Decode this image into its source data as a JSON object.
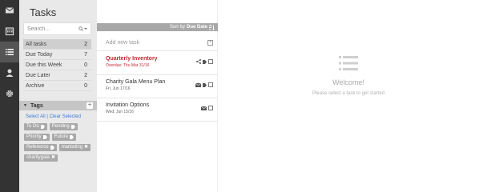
{
  "sidebar": {
    "title": "Tasks",
    "search_placeholder": "Search...",
    "filters": [
      {
        "label": "All tasks",
        "count": "2"
      },
      {
        "label": "Due Today",
        "count": "7"
      },
      {
        "label": "Due this Week",
        "count": "0"
      },
      {
        "label": "Due Later",
        "count": "2"
      },
      {
        "label": "Archive",
        "count": "0"
      }
    ],
    "tags_header": "Tags",
    "select_all": "Select All",
    "clear_selected": "Clear Selected",
    "tags": [
      {
        "label": "To Do"
      },
      {
        "label": "Pending"
      },
      {
        "label": "Priority"
      },
      {
        "label": "Future"
      },
      {
        "label": "Reference"
      },
      {
        "label": "marketing"
      },
      {
        "label": "charitygala"
      }
    ]
  },
  "tasklist": {
    "sort_label": "Sort by",
    "sort_value": "Due Date",
    "add_placeholder": "Add new task",
    "tasks": [
      {
        "title": "Quarterly Inventory",
        "date": "Overdue: Thu Mar 31/16"
      },
      {
        "title": "Charity Gala Menu Plan",
        "date": "Fri, Jun 17/16"
      },
      {
        "title": "Invitation Options",
        "date": "Wed, Jun 15/16"
      }
    ]
  },
  "content": {
    "welcome": "Welcome!",
    "hint": "Please select a task to get started"
  },
  "colors": {
    "rail": "#333333",
    "accent": "#3ab0a4",
    "overdue": "#c0272d",
    "link": "#3a7bd5"
  }
}
